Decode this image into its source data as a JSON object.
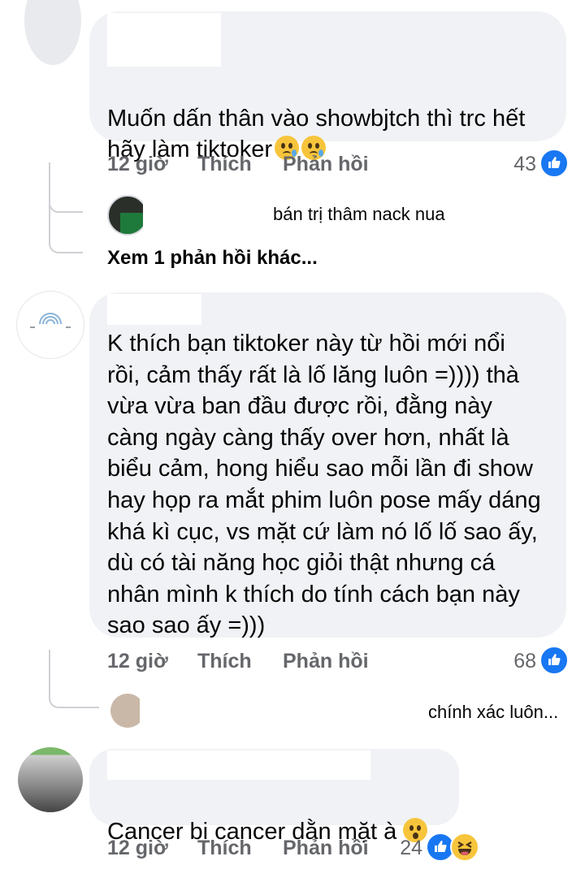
{
  "comments": [
    {
      "text": "Muốn dấn thân vào showbjtch thì trc hết\nhãy làm tiktoker",
      "emoji": "sad-tear-emoji",
      "time": "12 giờ",
      "like": "Thích",
      "reply": "Phản hồi",
      "reactions": "43"
    },
    {
      "text": "K thích bạn tiktoker này từ hồi mới nổi\nrồi, cảm thấy rất là lố lăng luôn =)))) thà\nvừa vừa ban đầu được rồi, đằng này\ncàng ngày càng thấy over hơn, nhất là\nbiểu cảm, hong hiểu sao mỗi lần đi show\nhay họp ra mắt phim luôn pose mấy dáng\nkhá kì cục, vs mặt cứ làm nó lố lố sao ấy,\ndù có tài năng học giỏi thật nhưng cá\nnhân mình k thích do tính cách bạn này\nsao sao ấy =)))",
      "time": "12 giờ",
      "like": "Thích",
      "reply": "Phản hồi",
      "reactions": "68"
    },
    {
      "text": "Cancer bị cancer dằn mặt à",
      "emoji": "hushed-face-emoji",
      "time": "12 giờ",
      "like": "Thích",
      "reply": "Phản hồi",
      "reactions": "24"
    }
  ],
  "replies": [
    {
      "preview": "bán trị thâm nack nua"
    },
    {
      "preview": "chính xác luôn..."
    }
  ],
  "more_replies": "Xem 1 phản hồi khác...",
  "colors": {
    "bubble": "#f0f2f5",
    "meta": "#65676b",
    "like_blue": "#1877f2",
    "haha_yellow": "#f7c53c"
  }
}
